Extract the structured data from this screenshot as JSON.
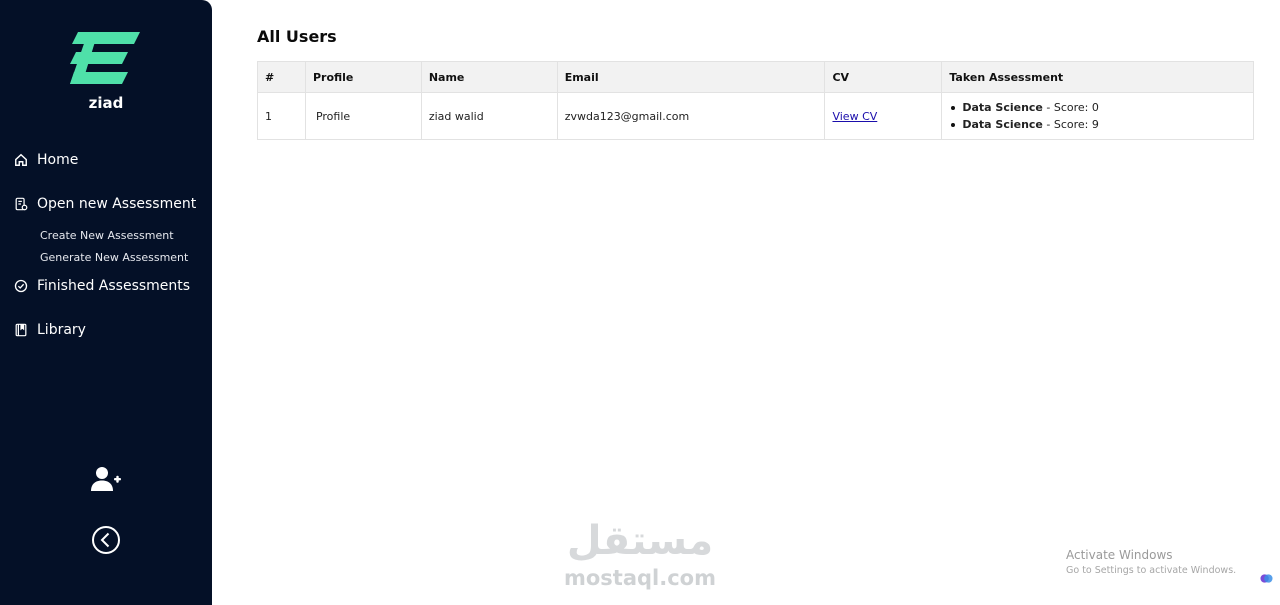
{
  "brand": {
    "name": "ziad",
    "accent": "#4fe0a9"
  },
  "sidebar": {
    "background": "#041027",
    "items": [
      {
        "label": "Home",
        "icon": "home-icon"
      },
      {
        "label": "Open new Assessment",
        "icon": "assessment-doc-icon"
      },
      {
        "label": "Finished Assessments",
        "icon": "check-circle-icon"
      },
      {
        "label": "Library",
        "icon": "book-icon"
      }
    ],
    "sub_items": [
      {
        "label": "Create New Assessment"
      },
      {
        "label": "Generate New Assessment"
      }
    ],
    "bottom_buttons": [
      {
        "icon": "add-user-icon"
      },
      {
        "icon": "back-chevron-icon"
      }
    ]
  },
  "main": {
    "title": "All Users",
    "table": {
      "columns": [
        "#",
        "Profile",
        "Name",
        "Email",
        "CV",
        "Taken Assessment"
      ],
      "rows": [
        {
          "index": "1",
          "profile_alt": "Profile",
          "name": "ziad walid",
          "email": "zvwda123@gmail.com",
          "cv_label": "View CV",
          "assessments": [
            {
              "name": "Data Science",
              "score_text": " - Score: 0"
            },
            {
              "name": "Data Science",
              "score_text": " - Score: 9"
            }
          ]
        }
      ]
    }
  },
  "watermark": {
    "arabic": "مستقل",
    "latin": "mostaql.com"
  },
  "windows_activation": {
    "title": "Activate Windows",
    "subtitle": "Go to Settings to activate Windows."
  }
}
